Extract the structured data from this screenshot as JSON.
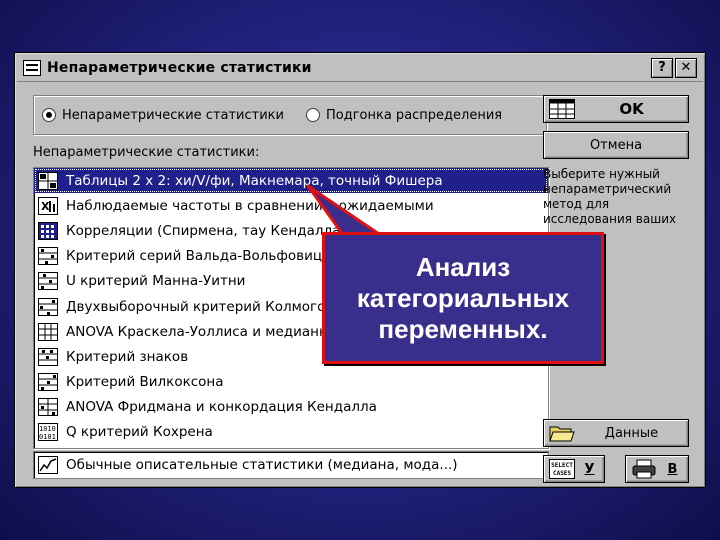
{
  "window": {
    "title": "Непараметрические статистики",
    "help_label": "?",
    "close_label": "✕"
  },
  "radios": [
    {
      "label": "Непараметрические статистики",
      "checked": true
    },
    {
      "label": "Подгонка распределения",
      "checked": false
    }
  ],
  "list_label": "Непараметрические статистики:",
  "methods": [
    {
      "label": "Таблицы 2 x 2:  хи/V/фи, Макнемара, точный Фишера",
      "icon": "table-2x2-icon",
      "selected": true
    },
    {
      "label": "Наблюдаемые частоты в сравнении с ожидаемыми",
      "icon": "frequency-icon"
    },
    {
      "label": "Корреляции (Спирмена, тау Кендалла)",
      "icon": "correlation-icon"
    },
    {
      "label": "Критерий серий Вальда-Вольфовица",
      "icon": "runs-test-icon"
    },
    {
      "label": "U критерий Манна-Уитни",
      "icon": "mann-whitney-icon"
    },
    {
      "label": "Двухвыборочный критерий Колмогорова-Смирнова",
      "icon": "kolmogorov-icon"
    },
    {
      "label": "ANOVA Краскела-Уоллиса и медианный тест",
      "icon": "kruskal-icon"
    },
    {
      "label": "Критерий знаков",
      "icon": "sign-test-icon"
    },
    {
      "label": "Критерий Вилкоксона",
      "icon": "wilcoxon-icon"
    },
    {
      "label": "ANOVA Фридмана и конкордация Кендалла",
      "icon": "friedman-icon"
    },
    {
      "label": "Q критерий Кохрена",
      "icon": "cochran-icon"
    }
  ],
  "descriptive": {
    "label": "Обычные описательные статистики (медиана, мода...)",
    "icon": "descriptive-icon"
  },
  "buttons": {
    "ok": "OK",
    "cancel": "Отмена",
    "data": "Данные",
    "select_cases": "У",
    "print": "В",
    "select_icon_text": "SELECT CASES"
  },
  "hint": "Выберите нужный непараметрический метод для исследования ваших",
  "callout": {
    "line1": "Анализ",
    "line2": "категориальных",
    "line3": "переменных.",
    "border_color": "#e01010",
    "fill_color": "#3a2e8c"
  },
  "colors": {
    "selection": "#20208a",
    "background": "#20207a",
    "dialog": "#c0c0c0"
  }
}
